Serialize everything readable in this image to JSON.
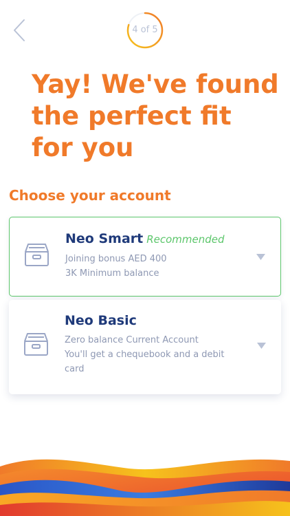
{
  "header": {
    "back_icon": "chevron-left-icon",
    "step_indicator": "4 of 5",
    "step_progress": 0.8
  },
  "headline": "Yay! We've found the perfect fit for you",
  "section_title": "Choose your account",
  "accounts": [
    {
      "name": "Neo Smart",
      "badge": "Recommended",
      "lines": [
        "Joining bonus AED 400",
        "3K Minimum balance"
      ],
      "selected": true,
      "icon": "drawer-icon",
      "expand_icon": "chevron-down-icon"
    },
    {
      "name": "Neo Basic",
      "lines": [
        "Zero balance Current Account",
        "You'll get a chequebook and a debit",
        "card"
      ],
      "selected": false,
      "icon": "drawer-icon",
      "expand_icon": "chevron-down-icon"
    }
  ],
  "colors": {
    "accent_orange": "#f07a2a",
    "title_navy": "#1f3a7a",
    "recommended_green": "#5cc66b",
    "muted_text": "#8e98b3",
    "icon_stroke": "#9aa6c6"
  }
}
